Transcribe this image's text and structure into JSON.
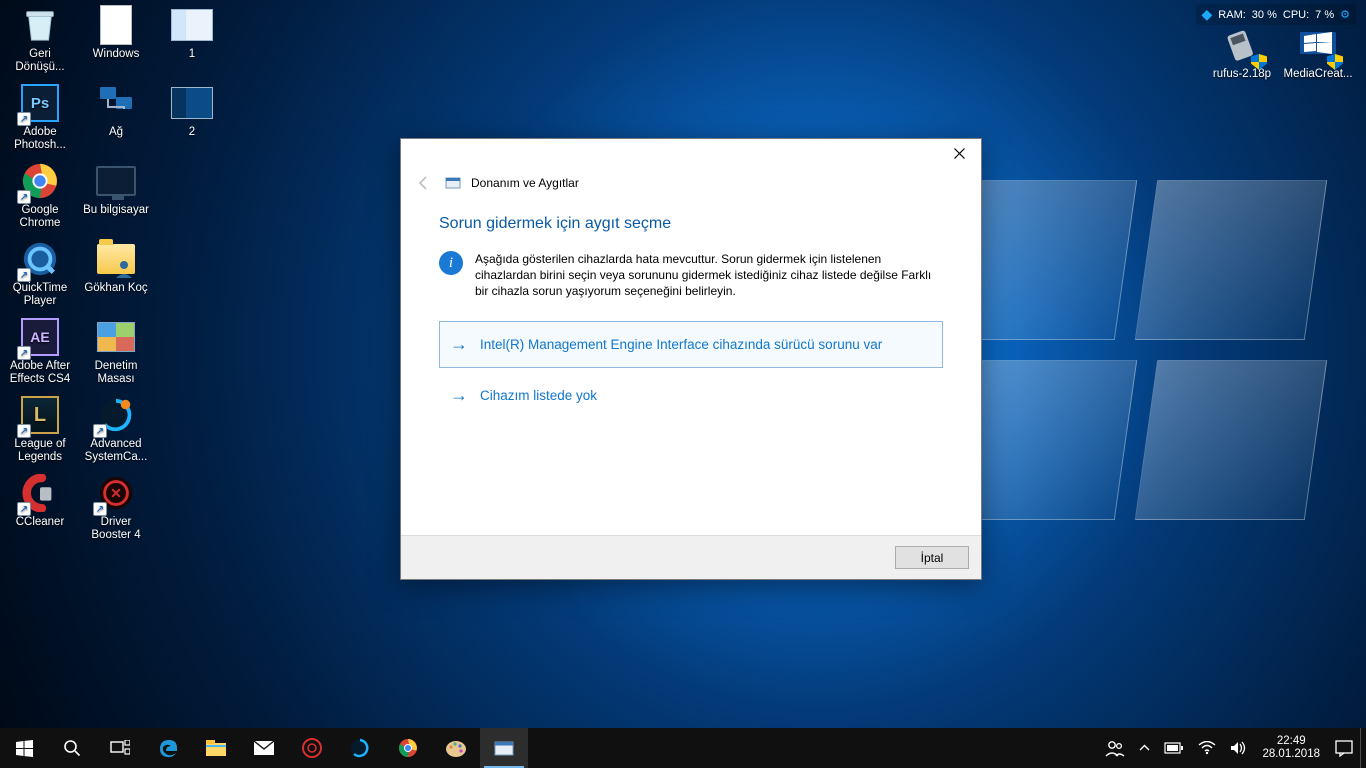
{
  "sysmon": {
    "ram_label": "RAM:",
    "ram_value": "30 %",
    "cpu_label": "CPU:",
    "cpu_value": "7 %"
  },
  "desktop_icons": {
    "col1": [
      {
        "name": "recycle-bin",
        "label": "Geri Dönüşü..."
      },
      {
        "name": "adobe-photoshop",
        "label": "Adobe Photosh..."
      },
      {
        "name": "google-chrome",
        "label": "Google Chrome"
      },
      {
        "name": "quicktime-player",
        "label": "QuickTime Player"
      },
      {
        "name": "adobe-after-effects",
        "label": "Adobe After Effects CS4"
      },
      {
        "name": "league-of-legends",
        "label": "League of Legends"
      },
      {
        "name": "ccleaner",
        "label": "CCleaner"
      }
    ],
    "col2": [
      {
        "name": "windows-folder",
        "label": "Windows"
      },
      {
        "name": "network",
        "label": "Ağ"
      },
      {
        "name": "this-pc",
        "label": "Bu bilgisayar"
      },
      {
        "name": "user-folder",
        "label": "Gökhan Koç"
      },
      {
        "name": "control-panel",
        "label": "Denetim Masası"
      },
      {
        "name": "advanced-systemcare",
        "label": "Advanced SystemCa..."
      },
      {
        "name": "driver-booster",
        "label": "Driver Booster 4"
      }
    ],
    "col3": [
      {
        "name": "screenshot-1",
        "label": "1"
      },
      {
        "name": "screenshot-2",
        "label": "2"
      }
    ],
    "right": [
      {
        "name": "rufus",
        "label": "rufus-2.18p"
      },
      {
        "name": "media-creation-tool",
        "label": "MediaCreat..."
      }
    ]
  },
  "dialog": {
    "wizard_title": "Donanım ve Aygıtlar",
    "heading": "Sorun gidermek için aygıt seçme",
    "info_text": "Aşağıda gösterilen cihazlarda hata mevcuttur. Sorun gidermek için listelenen cihazlardan birini seçin veya sorununu gidermek istediğiniz cihaz listede değilse Farklı bir cihazla sorun yaşıyorum seçeneğini belirleyin.",
    "option1": "Intel(R) Management Engine Interface  cihazında sürücü sorunu var",
    "option2": "Cihazım listede yok",
    "cancel": "İptal"
  },
  "taskbar": {
    "clock_time": "22:49",
    "clock_date": "28.01.2018"
  }
}
